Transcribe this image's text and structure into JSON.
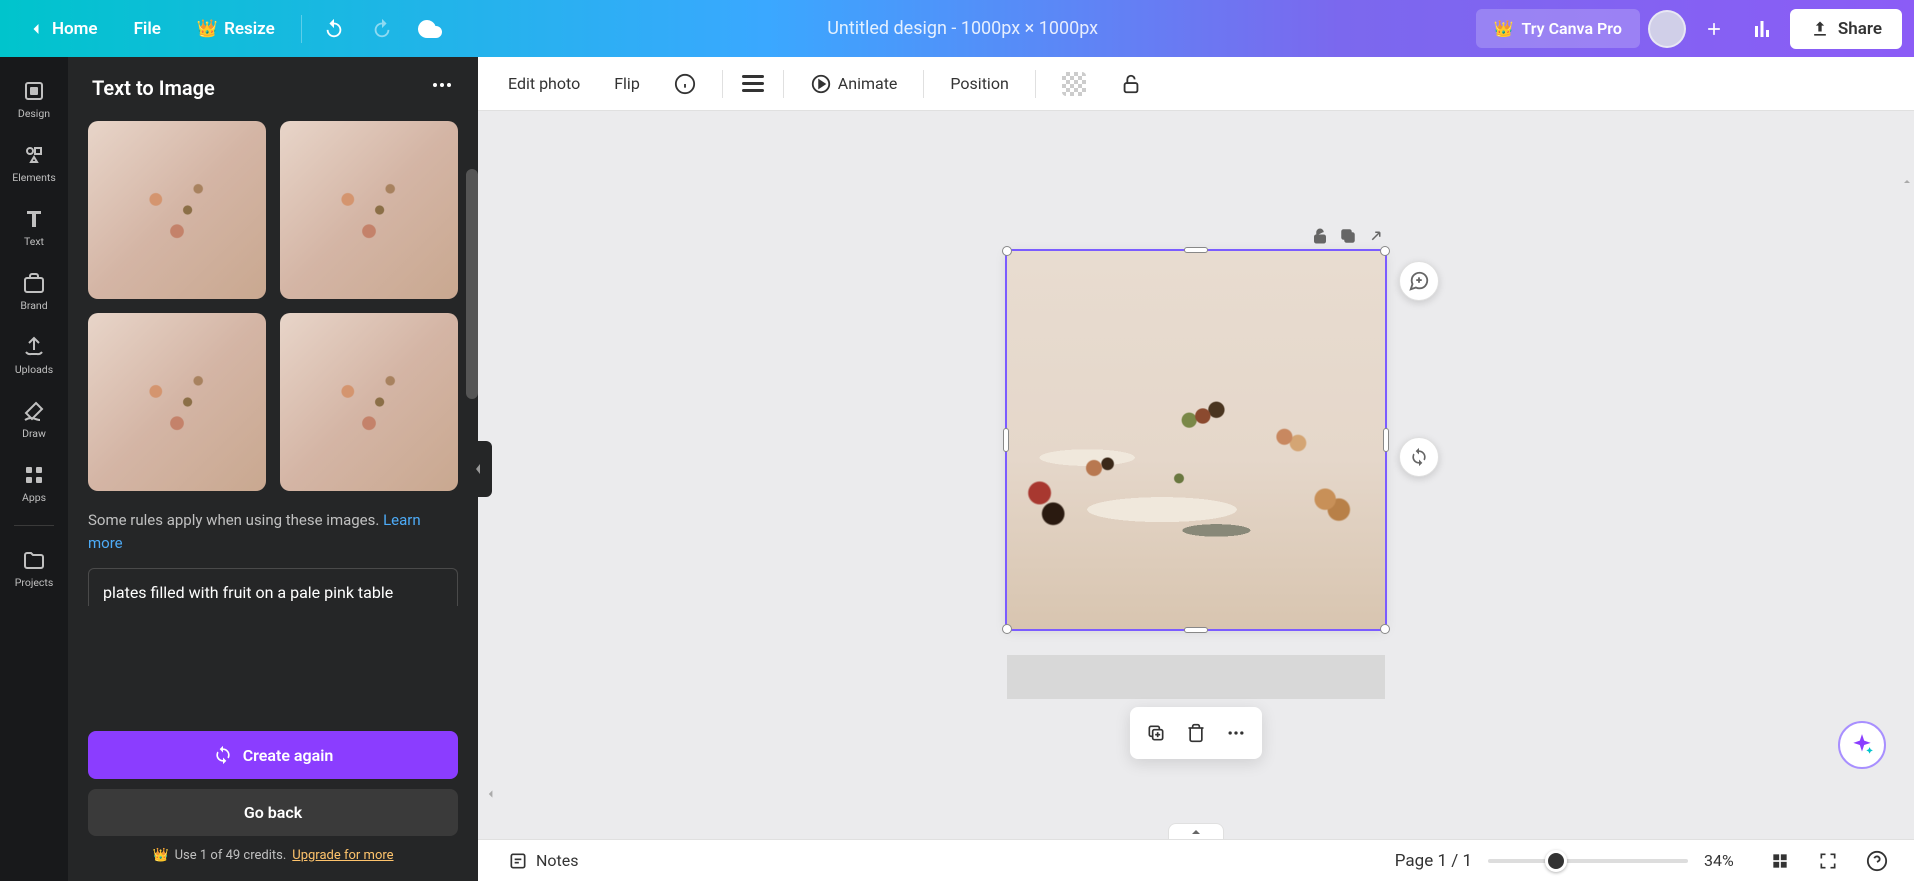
{
  "header": {
    "home": "Home",
    "file": "File",
    "resize": "Resize",
    "design_title": "Untitled design - 1000px × 1000px",
    "try_pro": "Try Canva Pro",
    "share": "Share"
  },
  "sidebar": {
    "items": [
      {
        "label": "Design",
        "icon": "design"
      },
      {
        "label": "Elements",
        "icon": "elements"
      },
      {
        "label": "Text",
        "icon": "text"
      },
      {
        "label": "Brand",
        "icon": "brand"
      },
      {
        "label": "Uploads",
        "icon": "uploads"
      },
      {
        "label": "Draw",
        "icon": "draw"
      },
      {
        "label": "Apps",
        "icon": "apps"
      },
      {
        "label": "Projects",
        "icon": "projects"
      }
    ]
  },
  "panel": {
    "title": "Text to Image",
    "rules_text": "Some rules apply when using these images. ",
    "learn_more": "Learn more",
    "prompt_value": "plates filled with fruit on a pale pink table",
    "create_again": "Create again",
    "go_back": "Go back",
    "credits_prefix": "Use 1 of 49 credits. ",
    "upgrade": "Upgrade for more"
  },
  "toolbar": {
    "edit_photo": "Edit photo",
    "flip": "Flip",
    "animate": "Animate",
    "position": "Position"
  },
  "bottom": {
    "notes": "Notes",
    "page_indicator": "Page 1 / 1",
    "zoom": "34%"
  },
  "colors": {
    "accent": "#8b3dff",
    "selection": "#7b5cff"
  }
}
